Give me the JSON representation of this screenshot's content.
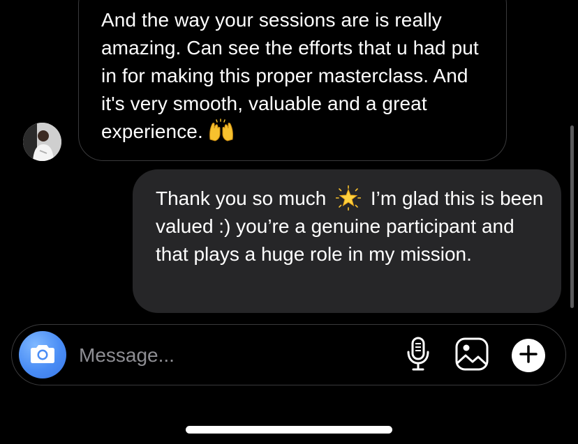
{
  "conversation": {
    "incoming_message": {
      "text": "And the way your sessions are is really amazing. Can see the efforts that u had put in for making this proper masterclass. And it's very smooth, valuable and a great experience.",
      "emoji": "raising-hands-icon"
    },
    "outgoing_message": {
      "text_before_emoji": "Thank you so much",
      "emoji": "glowing-star-icon",
      "text_after_emoji": "I’m glad this is been valued :) you’re a genuine participant and that plays a huge role in my mission."
    }
  },
  "composer": {
    "placeholder": "Message...",
    "value": "",
    "icons": [
      "camera-icon",
      "microphone-icon",
      "gallery-icon",
      "plus-icon"
    ]
  },
  "colors": {
    "background": "#000000",
    "outgoing_bubble": "#262628",
    "incoming_border": "#3a3a3c",
    "camera_button": "#4a8df5",
    "placeholder": "#8e8e93"
  }
}
